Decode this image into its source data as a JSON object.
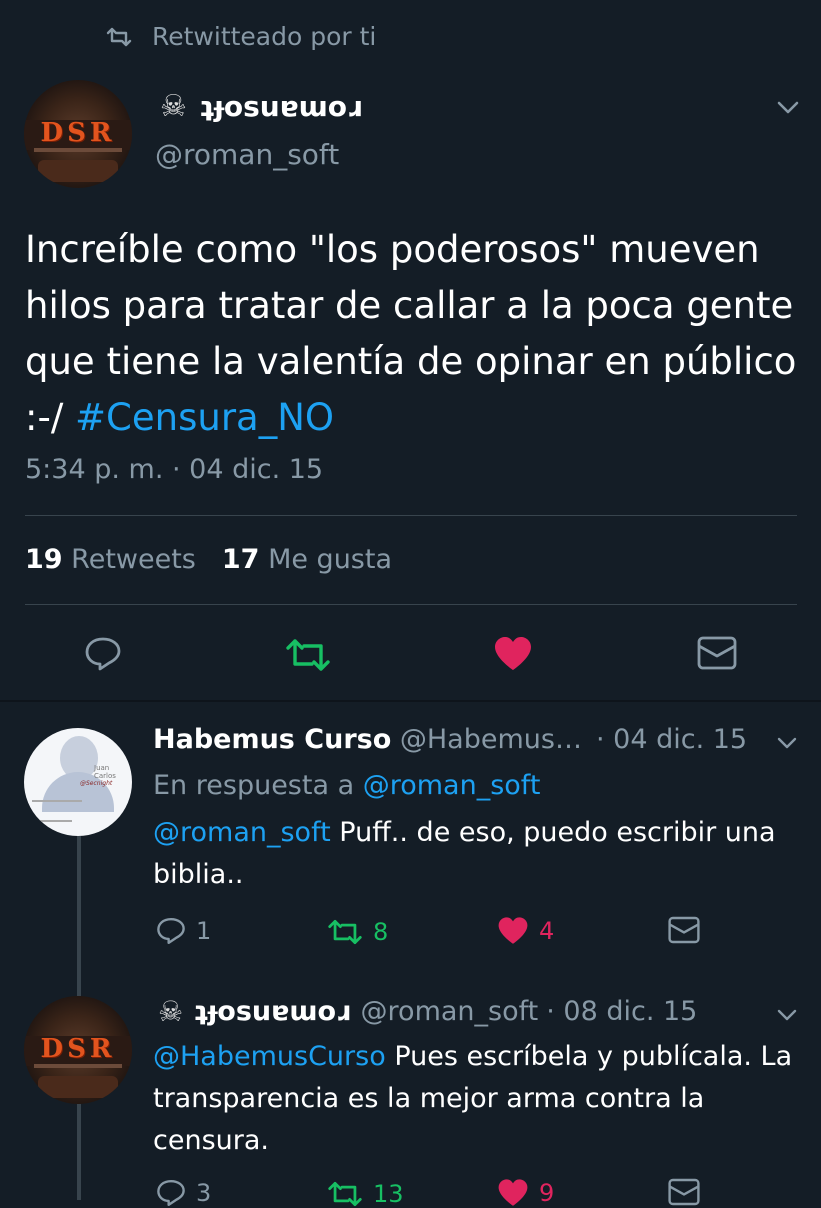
{
  "retweet_header": {
    "label": "Retwitteado por ti"
  },
  "main_tweet": {
    "display_name": "ʇɟosuɐɯoɹ",
    "handle": "@roman_soft",
    "text_before": "Increíble como \"los poderosos\" mueven hilos para tratar de callar a la poca gente que tiene la valentía de opinar en público :-/ ",
    "hashtag": "#Censura_NO",
    "timestamp": "5:34 p. m. · 04 dic. 15",
    "stats": {
      "retweets_count": "19",
      "retweets_label": "Retweets",
      "likes_count": "17",
      "likes_label": "Me gusta"
    }
  },
  "replies": [
    {
      "display_name": "Habemus Curso",
      "handle": "@Habemus…",
      "date": "· 04 dic. 15",
      "in_reply_prefix": "En respuesta a",
      "in_reply_handle": "@roman_soft",
      "mention": "@roman_soft",
      "text": " Puff.. de eso, puedo escribir una biblia..",
      "avatar_text_1": "Juan Carlos",
      "avatar_text_2": "@Secnight",
      "replies": "1",
      "retweets": "8",
      "likes": "4"
    },
    {
      "display_name": "ʇɟosuɐɯoɹ",
      "handle": "@roman_soft",
      "date": "· 08 dic. 15",
      "mention": "@HabemusCurso",
      "text": " Pues escríbela y publícala. La transparencia es la mejor arma contra la censura.",
      "replies": "3",
      "retweets": "13",
      "likes": "9"
    }
  ],
  "avatar_logo": "DSR",
  "colors": {
    "background": "#141d26",
    "accent": "#1da1f2",
    "retweet": "#17bf63",
    "like": "#e0245e",
    "muted": "#8899a6"
  }
}
